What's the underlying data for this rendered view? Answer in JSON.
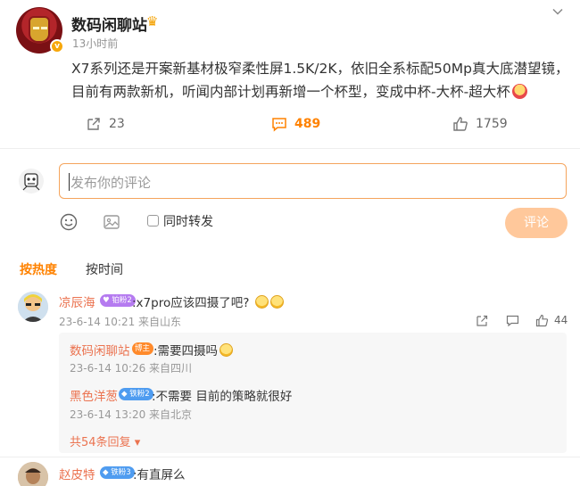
{
  "post": {
    "author": "数码闲聊站",
    "timestamp": "13小时前",
    "text": "X7系列还是开案新基材极窄柔性屏1.5K/2K，依旧全系标配50Mp真大底潜望镜，目前有两款新机，听闻内部计划再新增一个杯型，变成中杯-大杯-超大杯",
    "forward_count": "23",
    "comment_count": "489",
    "like_count": "1759",
    "accent_color": "#ff8200"
  },
  "composer": {
    "placeholder": "发布你的评论",
    "repost_label": "同时转发",
    "submit_label": "评论"
  },
  "sort": {
    "hot_label": "按热度",
    "time_label": "按时间"
  },
  "comments": [
    {
      "user": "凉辰海",
      "badge": "铂粉2",
      "text": ":x7pro应该四摄了吧?",
      "meta": "23-6-14 10:21 来自山东",
      "like_count": "44",
      "replies": [
        {
          "user": "数码闲聊站",
          "badge": "博主",
          "text": ":需要四摄吗",
          "meta": "23-6-14 10:26 来自四川"
        },
        {
          "user": "黑色洋葱",
          "badge": "铁粉2",
          "text": ":不需要 目前的策略就很好",
          "meta": "23-6-14 13:20 来自北京"
        }
      ],
      "more_replies": "共54条回复"
    },
    {
      "user": "赵皮特",
      "badge": "铁粉3",
      "text": ":有直屏么"
    }
  ]
}
